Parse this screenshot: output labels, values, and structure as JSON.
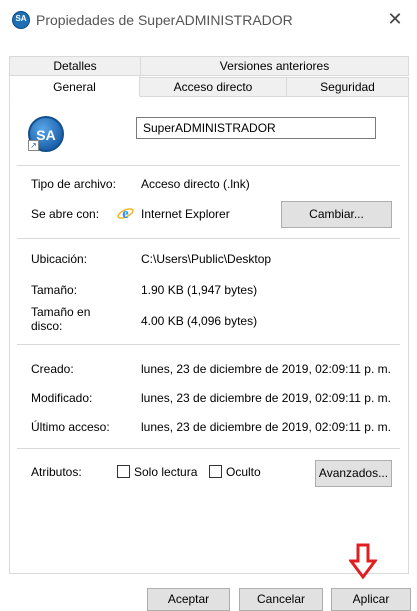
{
  "window": {
    "title": "Propiedades de SuperADMINISTRADOR",
    "close_glyph": "✕"
  },
  "tabs_back": [
    "Detalles",
    "Versiones anteriores"
  ],
  "tabs_front": [
    "General",
    "Acceso directo",
    "Seguridad"
  ],
  "active_tab": "General",
  "general": {
    "name_value": "SuperADMINISTRADOR",
    "icon_text": "SA",
    "file_type_label": "Tipo de archivo:",
    "file_type_value": "Acceso directo (.lnk)",
    "opens_with_label": "Se abre con:",
    "opens_with_value": "Internet Explorer",
    "change_button": "Cambiar...",
    "location_label": "Ubicación:",
    "location_value": "C:\\Users\\Public\\Desktop",
    "size_label": "Tamaño:",
    "size_value": "1.90 KB (1,947 bytes)",
    "size_on_disk_label_1": "Tamaño en",
    "size_on_disk_label_2": "disco:",
    "size_on_disk_value": "4.00 KB (4,096 bytes)",
    "created_label": "Creado:",
    "created_value": "lunes, 23 de diciembre de 2019, 02:09:11 p. m.",
    "modified_label": "Modificado:",
    "modified_value": "lunes, 23 de diciembre de 2019, 02:09:11 p. m.",
    "accessed_label": "Último acceso:",
    "accessed_value": "lunes, 23 de diciembre de 2019, 02:09:11 p. m.",
    "attributes_label": "Atributos:",
    "readonly_label": "Solo lectura",
    "readonly_checked": false,
    "hidden_label": "Oculto",
    "hidden_checked": false,
    "advanced_button": "Avanzados..."
  },
  "footer": {
    "ok_button": "Aceptar",
    "cancel_button": "Cancelar",
    "apply_button": "Aplicar"
  },
  "colors": {
    "accent_arrow": "#e02020",
    "ie_blue": "#1e90ff"
  }
}
